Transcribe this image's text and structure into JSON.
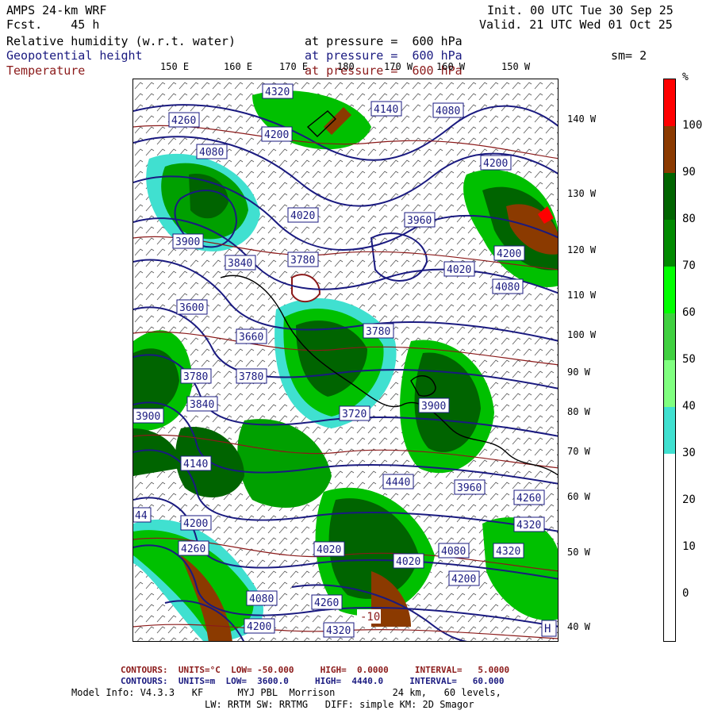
{
  "header": {
    "model": "AMPS 24-km WRF",
    "fcst": "Fcst.    45 h",
    "init": "Init. 00 UTC Tue 30 Sep 25",
    "valid": "Valid. 21 UTC Wed 01 Oct 25",
    "fields": [
      {
        "name": "Relative humidity (w.r.t. water)",
        "level": "at pressure =  600 hPa"
      },
      {
        "name": "Geopotential height",
        "level": "at pressure =  600 hPa"
      },
      {
        "name": "Temperature",
        "level": "at pressure =  600 hPa"
      }
    ],
    "smooth": "sm= 2"
  },
  "lon_labels": [
    "150 E",
    "160 E",
    "170 E",
    "180",
    "170 W",
    "160 W",
    "150 W"
  ],
  "lat_labels": [
    "140 W",
    "130 W",
    "120 W",
    "110 W",
    "100 W",
    "90 W",
    "80 W",
    "70 W",
    "60 W",
    "50 W",
    "40 W"
  ],
  "colorbar": {
    "unit": "%",
    "labels": [
      "100",
      "90",
      "80",
      "70",
      "60",
      "50",
      "40",
      "30",
      "20",
      "10",
      "0"
    ],
    "colors": [
      "#ff0000",
      "#8b3a00",
      "#006400",
      "#00a000",
      "#00ff00",
      "#80ff80",
      "#40e0d0",
      "#ffffff",
      "#ffffff",
      "#ffffff",
      "#ffffff"
    ]
  },
  "height_labels": [
    "4320",
    "4260",
    "4200",
    "4140",
    "4080",
    "4020",
    "3960",
    "3900",
    "3840",
    "3780",
    "3720",
    "3660",
    "3600",
    "4440",
    "44"
  ],
  "temp_labels": [
    "-10",
    "H"
  ],
  "footer": {
    "temp_contours": "CONTOURS:  UNITS=°C  LOW= -50.000     HIGH=  0.0000     INTERVAL=   5.0000",
    "height_contours": "CONTOURS:  UNITS=m  LOW=  3600.0     HIGH=  4440.0     INTERVAL=   60.000",
    "model_info": "Model Info: V4.3.3   KF      MYJ PBL  Morrison          24 km,   60 levels,",
    "physics": "LW: RRTM SW: RRTMG   DIFF: simple KM: 2D Smagor"
  }
}
